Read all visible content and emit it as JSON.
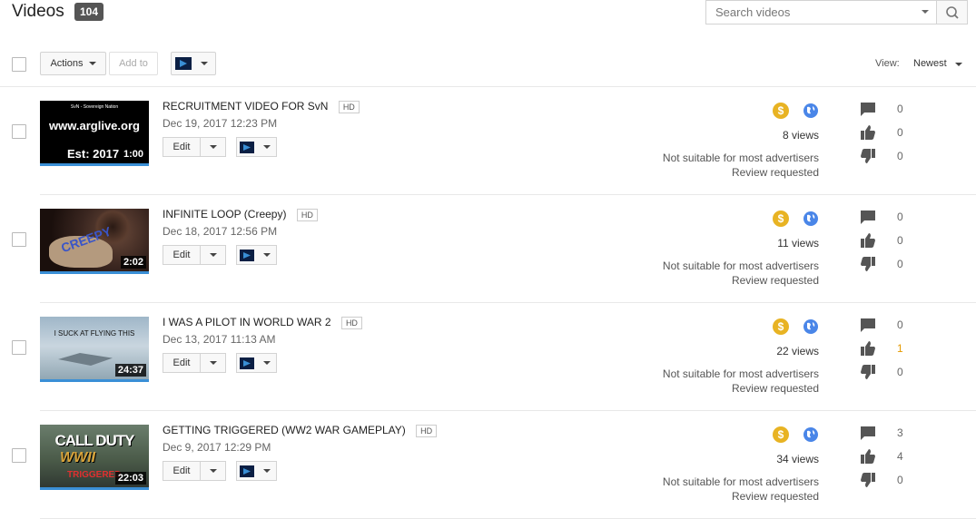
{
  "header": {
    "title": "Videos",
    "count": "104",
    "search_placeholder": "Search videos"
  },
  "toolbar": {
    "actions_label": "Actions",
    "add_to_label": "Add to",
    "view_label": "View:",
    "sort_label": "Newest"
  },
  "colors": {
    "accent": "#3a8fd6",
    "monetize": "#e8b323",
    "highlight": "#e59a00"
  },
  "videos": [
    {
      "title": "RECRUITMENT VIDEO FOR SvN",
      "hd": "HD",
      "date": "Dec 19, 2017 12:23 PM",
      "duration": "1:00",
      "views": "8 views",
      "notice1": "Not suitable for most advertisers",
      "notice2": "Review requested",
      "comments": "0",
      "likes": "0",
      "dislikes": "0",
      "edit_label": "Edit",
      "thumb": {
        "line1": "SvN - Sovereign Nation",
        "line2": "www.arglive.org",
        "line3": "Est: 2017"
      }
    },
    {
      "title": "INFINITE LOOP (Creepy)",
      "hd": "HD",
      "date": "Dec 18, 2017 12:56 PM",
      "duration": "2:02",
      "views": "11 views",
      "notice1": "Not suitable for most advertisers",
      "notice2": "Review requested",
      "comments": "0",
      "likes": "0",
      "dislikes": "0",
      "edit_label": "Edit",
      "thumb": {
        "line1": "CREEPY"
      }
    },
    {
      "title": "I WAS A PILOT IN WORLD WAR 2",
      "hd": "HD",
      "date": "Dec 13, 2017 11:13 AM",
      "duration": "24:37",
      "views": "22 views",
      "notice1": "Not suitable for most advertisers",
      "notice2": "Review requested",
      "comments": "0",
      "likes": "1",
      "dislikes": "0",
      "edit_label": "Edit",
      "thumb": {
        "line1": "I SUCK AT FLYING THIS"
      }
    },
    {
      "title": "GETTING TRIGGERED (WW2 WAR GAMEPLAY)",
      "hd": "HD",
      "date": "Dec 9, 2017 12:29 PM",
      "duration": "22:03",
      "views": "34 views",
      "notice1": "Not suitable for most advertisers",
      "notice2": "Review requested",
      "comments": "3",
      "likes": "4",
      "dislikes": "0",
      "edit_label": "Edit",
      "thumb": {
        "line1": "CALL DUTY",
        "line2": "WWII",
        "line3": "TRIGGERED"
      }
    }
  ]
}
